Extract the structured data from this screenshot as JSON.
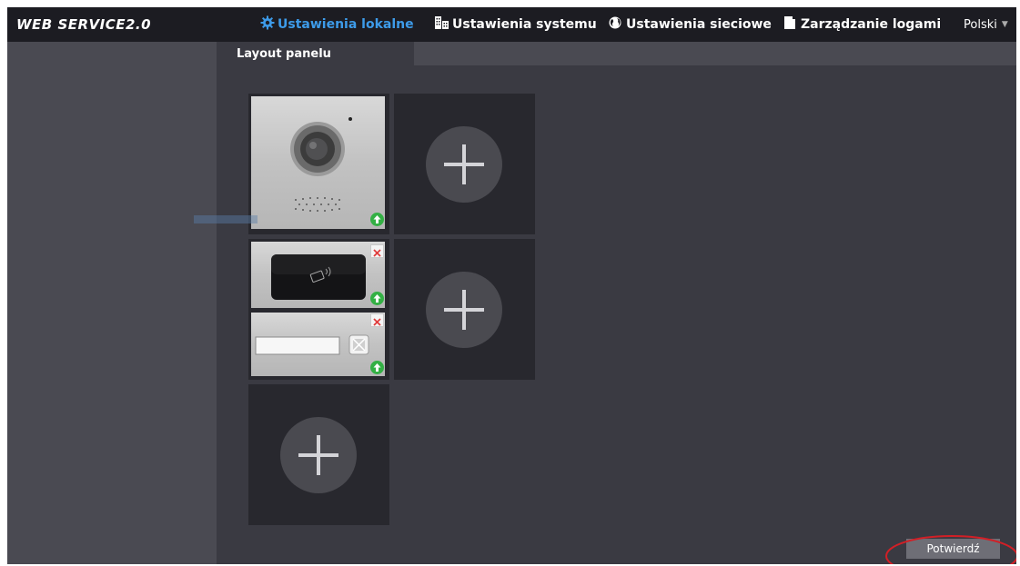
{
  "app": {
    "logo": "WEB SERVICE2.0"
  },
  "nav": {
    "items": [
      {
        "label": "Ustawienia lokalne",
        "icon": "gear-icon",
        "active": true
      },
      {
        "label": "Ustawienia systemu",
        "icon": "building-icon",
        "active": false
      },
      {
        "label": "Ustawienia sieciowe",
        "icon": "globe-icon",
        "active": false
      },
      {
        "label": "Zarządzanie logami",
        "icon": "document-icon",
        "active": false
      }
    ],
    "language": "Polski"
  },
  "subtabs": {
    "active_label": "Layout panelu"
  },
  "panel_layout": {
    "modules": [
      {
        "type": "camera-module",
        "column": 1,
        "row": 1,
        "actions": [
          "move-up"
        ]
      },
      {
        "type": "card-reader-module",
        "column": 1,
        "row": 2,
        "actions": [
          "delete",
          "move-up"
        ]
      },
      {
        "type": "keypad-module",
        "column": 1,
        "row": 2,
        "actions": [
          "delete",
          "move-up"
        ]
      }
    ],
    "empty_slots": [
      {
        "column": 2,
        "row": 1,
        "icon": "plus-icon"
      },
      {
        "column": 2,
        "row": 2,
        "icon": "plus-icon"
      },
      {
        "column": 1,
        "row": 3,
        "icon": "plus-icon"
      }
    ]
  },
  "footer": {
    "confirm_label": "Potwierdź"
  },
  "colors": {
    "accent": "#3d9be9",
    "topbar": "#1c1c22",
    "content_bg": "#3a3a42",
    "sidebar_bg": "#4a4a52",
    "success": "#33b044",
    "danger": "#e03c3c",
    "highlight_ring": "#d21f26"
  }
}
